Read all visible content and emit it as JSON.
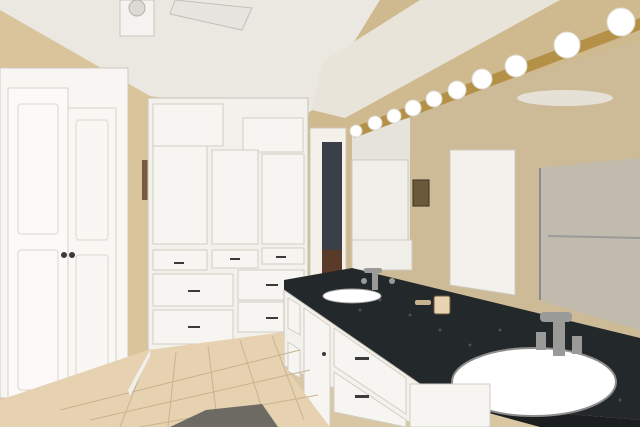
{
  "scene": {
    "kind": "photo",
    "subject": "bathroom",
    "palette": {
      "ceiling": "#ebe8e2",
      "wall": "#d8c39b",
      "wall_shadow": "#c2ab82",
      "cabinet": "#f3f1ec",
      "cabinet_edge": "#c9c4b9",
      "countertop": "#23282a",
      "countertop_fleck": "#4b4f4d",
      "sink": "#ffffff",
      "floor_tile": "#e6d2b0",
      "grout": "#c9b38f",
      "mirror_tint": "#c9c4b6",
      "brass": "#b49146",
      "bulb": "#ffffff",
      "chrome": "#9a9a98",
      "handle": "#3a3a3a",
      "rug": "#6c6a63",
      "door_frame": "#8e7a56"
    },
    "objects": [
      "bifold-closet-door",
      "tall-linen-cabinet",
      "open-doorway",
      "double-vanity",
      "granite-countertop",
      "undermount-sinks",
      "faucets",
      "vanity-mirror",
      "hollywood-light-bar",
      "ceiling-fan",
      "tile-floor",
      "bath-rug",
      "reflected-shower"
    ]
  }
}
